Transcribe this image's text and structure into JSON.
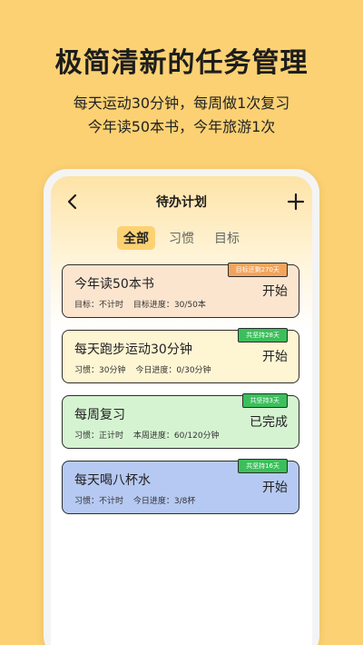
{
  "promo": {
    "title": "极简清新的任务管理",
    "subtitle_line1": "每天运动30分钟，每周做1次复习",
    "subtitle_line2": "今年读50本书，今年旅游1次"
  },
  "header": {
    "title": "待办计划"
  },
  "tabs": [
    {
      "label": "全部",
      "active": true
    },
    {
      "label": "习惯",
      "active": false
    },
    {
      "label": "目标",
      "active": false
    }
  ],
  "tasks": [
    {
      "title": "今年读50本书",
      "meta1": "目标：不计时",
      "meta2": "目标进度：30/50本",
      "action": "开始",
      "badge": "目标还剩270天",
      "card_color": "#fbe5cf",
      "badge_color": "orange"
    },
    {
      "title": "每天跑步运动30分钟",
      "meta1": "习惯：30分钟",
      "meta2": "今日进度：0/30分钟",
      "action": "开始",
      "badge": "共坚持28天",
      "card_color": "#fef5d3",
      "badge_color": "green"
    },
    {
      "title": "每周复习",
      "meta1": "习惯：正计时",
      "meta2": "本周进度：60/120分钟",
      "action": "已完成",
      "badge": "共坚持3天",
      "card_color": "#d5f3d1",
      "badge_color": "green"
    },
    {
      "title": "每天喝八杯水",
      "meta1": "习惯：不计时",
      "meta2": "今日进度：3/8杯",
      "action": "开始",
      "badge": "共坚持16天",
      "card_color": "#b6c9f2",
      "badge_color": "green"
    }
  ],
  "icons": {
    "back": "chevron-left-icon",
    "add": "plus-icon"
  }
}
